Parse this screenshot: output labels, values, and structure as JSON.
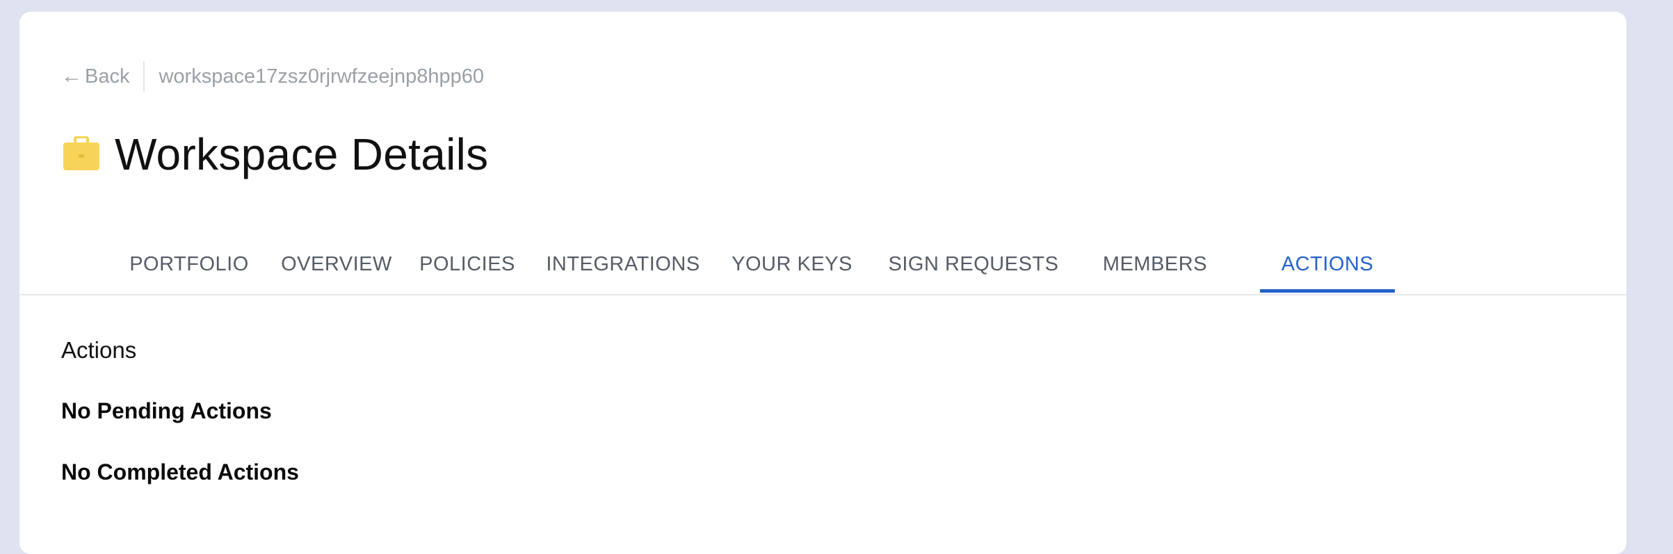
{
  "header": {
    "back_label": "Back",
    "workspace_id": "workspace17zsz0rjrwfzeejnp8hpp60",
    "title": "Workspace Details",
    "title_icon": "briefcase-icon",
    "back_icon": "arrow-left-icon"
  },
  "tabs": [
    {
      "label": "PORTFOLIO",
      "active": false
    },
    {
      "label": "OVERVIEW",
      "active": false
    },
    {
      "label": "POLICIES",
      "active": false
    },
    {
      "label": "INTEGRATIONS",
      "active": false
    },
    {
      "label": "YOUR KEYS",
      "active": false
    },
    {
      "label": "SIGN REQUESTS",
      "active": false
    },
    {
      "label": "MEMBERS",
      "active": false
    },
    {
      "label": "ACTIONS",
      "active": true
    }
  ],
  "main": {
    "section_title": "Actions",
    "pending_empty": "No Pending Actions",
    "completed_empty": "No Completed Actions"
  },
  "colors": {
    "page_background": "#dfe2f0",
    "card_background": "#ffffff",
    "accent": "#2563c9",
    "briefcase": "#f7d358",
    "muted_text": "#9aa0a6"
  }
}
